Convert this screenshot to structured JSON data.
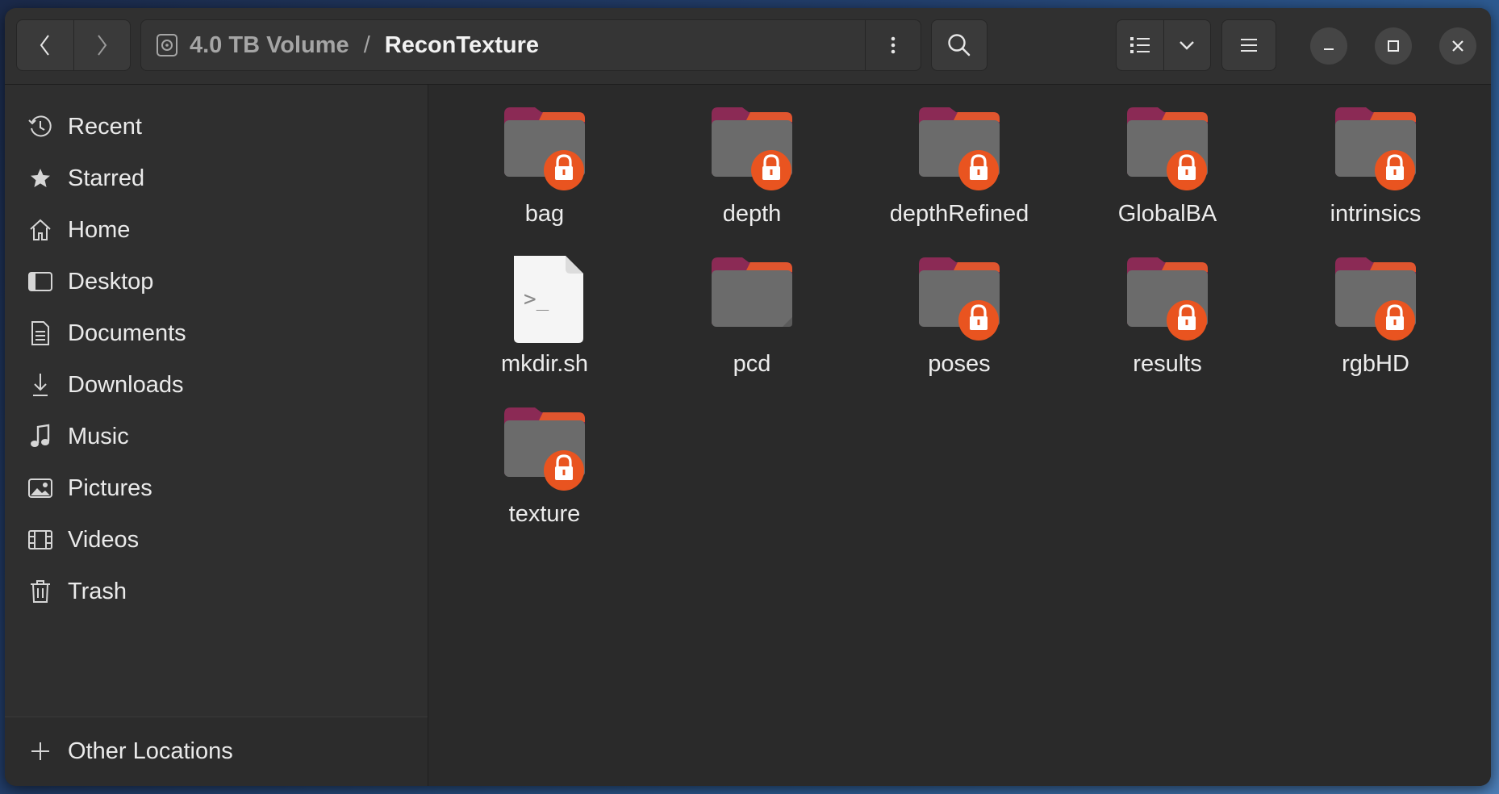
{
  "headerbar": {
    "back_icon": "chevron-left-icon",
    "forward_icon": "chevron-right-icon",
    "path_parent": "4.0 TB Volume",
    "path_separator": "/",
    "path_current": "ReconTexture",
    "path_menu_icon": "vertical-dots-icon",
    "search_icon": "search-icon",
    "view_icon": "list-view-icon",
    "view_dropdown_icon": "chevron-down-icon",
    "menu_icon": "hamburger-menu-icon",
    "minimize_icon": "minimize-icon",
    "maximize_icon": "maximize-icon",
    "close_icon": "close-icon"
  },
  "sidebar": {
    "items": [
      {
        "label": "Recent",
        "icon": "clock-icon"
      },
      {
        "label": "Starred",
        "icon": "star-icon"
      },
      {
        "label": "Home",
        "icon": "home-icon"
      },
      {
        "label": "Desktop",
        "icon": "desktop-icon"
      },
      {
        "label": "Documents",
        "icon": "documents-icon"
      },
      {
        "label": "Downloads",
        "icon": "download-icon"
      },
      {
        "label": "Music",
        "icon": "music-note-icon"
      },
      {
        "label": "Pictures",
        "icon": "picture-icon"
      },
      {
        "label": "Videos",
        "icon": "film-icon"
      },
      {
        "label": "Trash",
        "icon": "trash-icon"
      }
    ],
    "other_locations": {
      "label": "Other Locations",
      "icon": "plus-icon"
    }
  },
  "files": [
    {
      "name": "bag",
      "type": "folder",
      "locked": true
    },
    {
      "name": "depth",
      "type": "folder",
      "locked": true
    },
    {
      "name": "depthRefined",
      "type": "folder",
      "locked": true
    },
    {
      "name": "GlobalBA",
      "type": "folder",
      "locked": true
    },
    {
      "name": "intrinsics",
      "type": "folder",
      "locked": true
    },
    {
      "name": "mkdir.sh",
      "type": "script",
      "locked": false
    },
    {
      "name": "pcd",
      "type": "folder",
      "locked": false
    },
    {
      "name": "poses",
      "type": "folder",
      "locked": true
    },
    {
      "name": "results",
      "type": "folder",
      "locked": true
    },
    {
      "name": "rgbHD",
      "type": "folder",
      "locked": true
    },
    {
      "name": "texture",
      "type": "folder",
      "locked": true
    }
  ],
  "colors": {
    "lock_badge": "#e95420",
    "folder_body": "#6b6b6b",
    "folder_tab": "#8b2a55",
    "window_bg": "#2a2a2a"
  }
}
